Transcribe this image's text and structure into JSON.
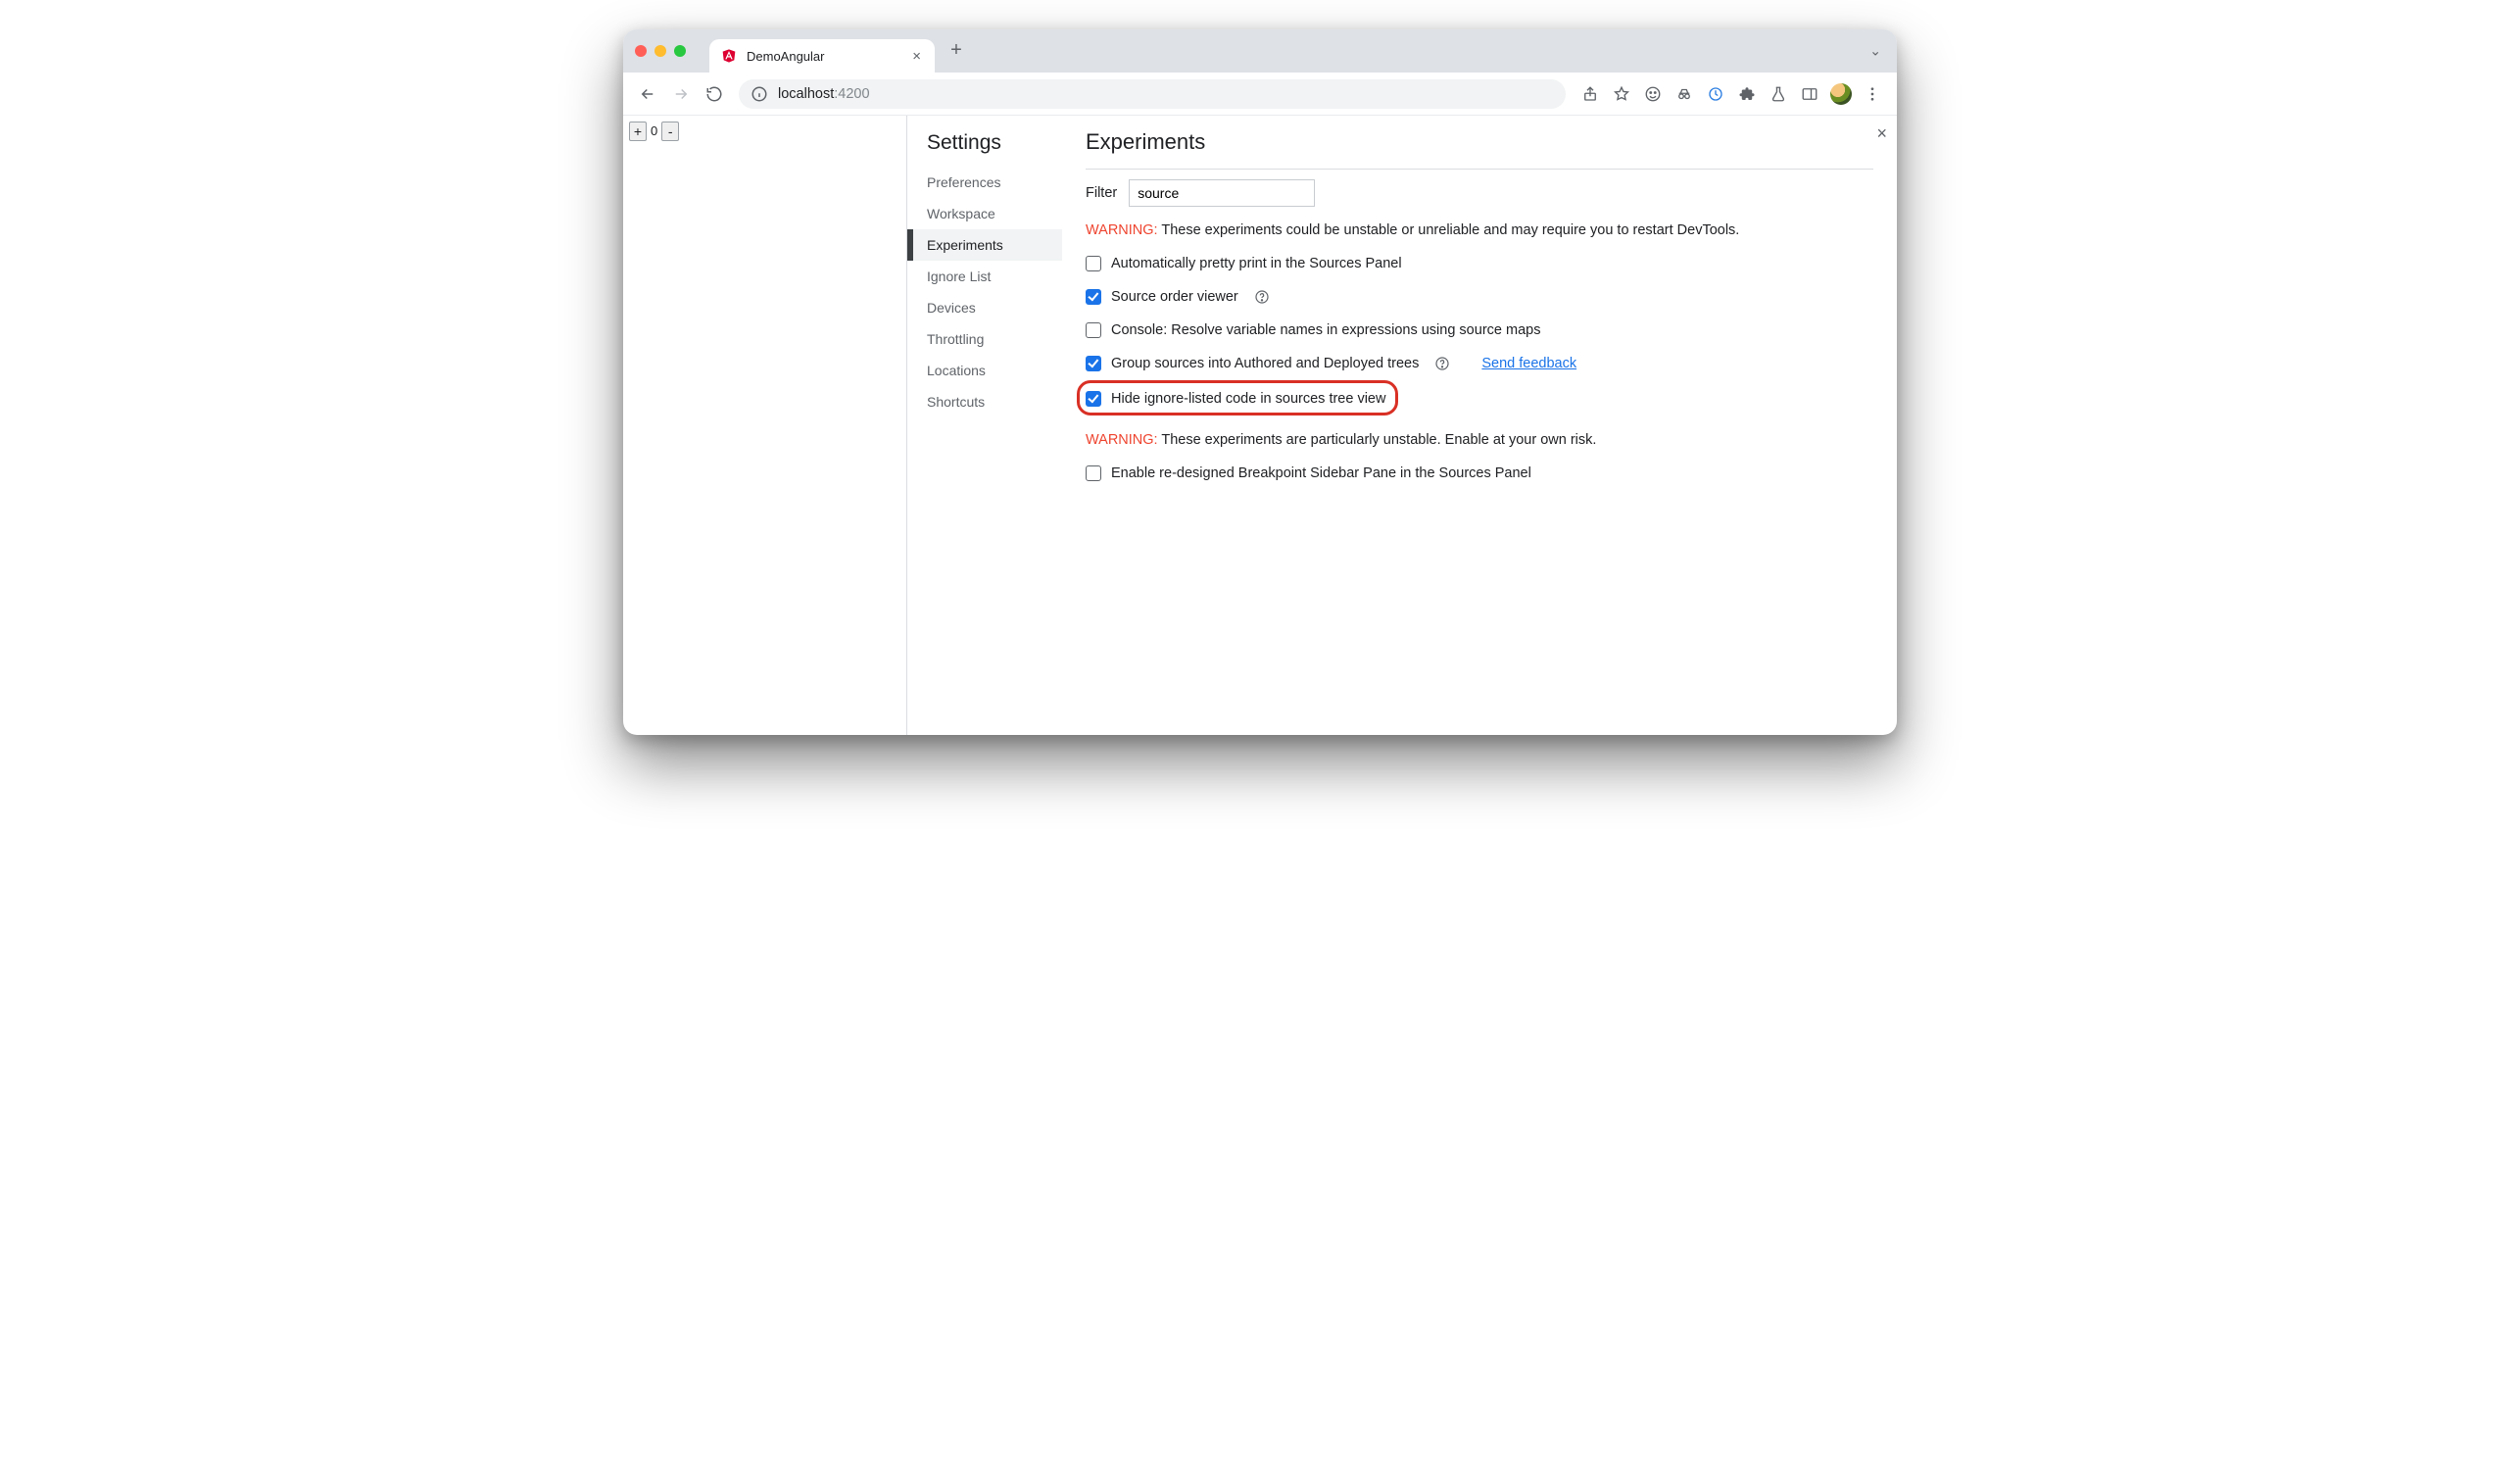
{
  "window": {
    "tab_title": "DemoAngular",
    "new_tab_glyph": "+",
    "tab_close_glyph": "×",
    "list_tabs_glyph": "⌄"
  },
  "toolbar": {
    "url_host": "localhost",
    "url_rest": ":4200"
  },
  "page": {
    "plus_label": "+",
    "count": "0",
    "minus_label": "-"
  },
  "settings": {
    "title": "Settings",
    "close_glyph": "×",
    "nav": [
      "Preferences",
      "Workspace",
      "Experiments",
      "Ignore List",
      "Devices",
      "Throttling",
      "Locations",
      "Shortcuts"
    ],
    "active_index": 2,
    "heading": "Experiments",
    "filter_label": "Filter",
    "filter_value": "source",
    "warning1_prefix": "WARNING:",
    "warning1_text": " These experiments could be unstable or unreliable and may require you to restart DevTools.",
    "experiments": [
      {
        "label": "Automatically pretty print in the Sources Panel",
        "checked": false,
        "help": false,
        "link": null,
        "highlight": false
      },
      {
        "label": "Source order viewer",
        "checked": true,
        "help": true,
        "link": null,
        "highlight": false
      },
      {
        "label": "Console: Resolve variable names in expressions using source maps",
        "checked": false,
        "help": false,
        "link": null,
        "highlight": false
      },
      {
        "label": "Group sources into Authored and Deployed trees",
        "checked": true,
        "help": true,
        "link": "Send feedback",
        "highlight": false
      },
      {
        "label": "Hide ignore-listed code in sources tree view",
        "checked": true,
        "help": false,
        "link": null,
        "highlight": true
      }
    ],
    "warning2_prefix": "WARNING:",
    "warning2_text": " These experiments are particularly unstable. Enable at your own risk.",
    "experiments2": [
      {
        "label": "Enable re-designed Breakpoint Sidebar Pane in the Sources Panel",
        "checked": false
      }
    ]
  }
}
